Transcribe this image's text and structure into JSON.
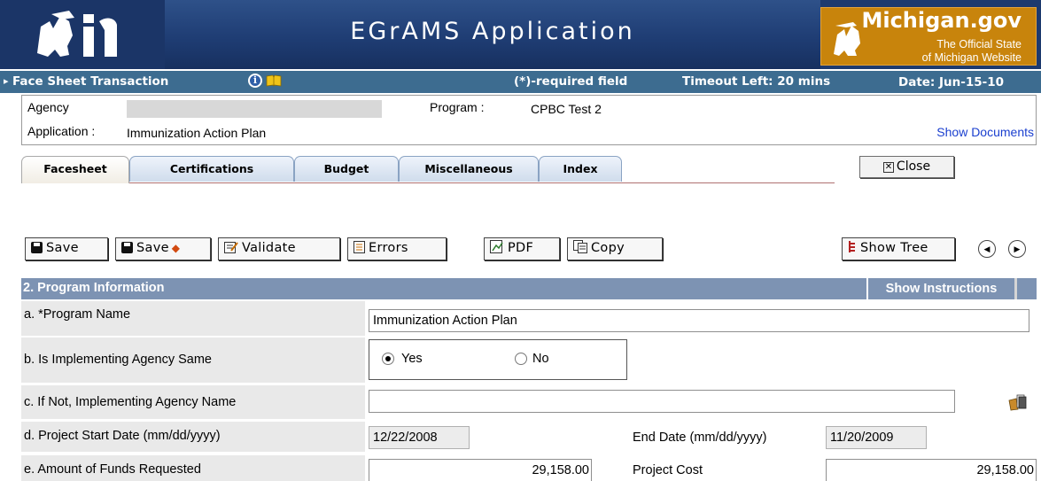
{
  "banner": {
    "app_title": "EGrAMS Application",
    "state_logo_text": "Mi",
    "mi_gov_title": "Michigan.gov",
    "mi_gov_sub1": "The Official State",
    "mi_gov_sub2": "of Michigan Website"
  },
  "status": {
    "title": "Face Sheet Transaction",
    "required": "(*)-required field",
    "timeout": "Timeout Left: 20  mins",
    "date": "Date: Jun-15-10"
  },
  "header": {
    "agency_label": "Agency",
    "agency_value": "",
    "program_label": "Program :",
    "program_value": "CPBC Test 2",
    "application_label": "Application :",
    "application_value": "Immunization Action Plan",
    "show_documents": "Show Documents"
  },
  "tabs": [
    {
      "label": "Facesheet",
      "active": true
    },
    {
      "label": "Certifications"
    },
    {
      "label": "Budget"
    },
    {
      "label": "Miscellaneous"
    },
    {
      "label": "Index"
    }
  ],
  "close_label": "Close",
  "toolbar": {
    "save": "Save",
    "save_plus": "Save",
    "validate": "Validate",
    "errors": "Errors",
    "pdf": "PDF",
    "copy": "Copy",
    "show_tree": "Show Tree"
  },
  "section": {
    "title": "2. Program Information",
    "instructions": "Show Instructions"
  },
  "form": {
    "a_label": "a. *Program Name",
    "a_value": "Immunization Action Plan",
    "b_label": "b. Is Implementing Agency Same",
    "b_yes": "Yes",
    "b_no": "No",
    "b_selected": "Yes",
    "c_label": "c. If Not, Implementing Agency Name",
    "c_value": "",
    "d_label": "d. Project Start Date (mm/dd/yyyy)",
    "d_start": "12/22/2008",
    "d_end_label": "End Date (mm/dd/yyyy)",
    "d_end": "11/20/2009",
    "e_label": "e. Amount of Funds Requested",
    "e_value": "29,158.00",
    "e_cost_label": "Project Cost",
    "e_cost": "29,158.00"
  },
  "colors": {
    "banner_blue": "#1f3d74",
    "status_bar": "#3d6c90",
    "section_bar": "#7d93b3",
    "mi_gov_orange": "#c8840c",
    "link": "#1a3fcf"
  },
  "icons": [
    "michigan-logo-icon",
    "michigan-map-icon",
    "info-icon",
    "book-icon",
    "save-disk-icon",
    "save-plus-icon",
    "validate-icon",
    "errors-icon",
    "pdf-icon",
    "copy-icon",
    "tree-icon",
    "prev-arrow-icon",
    "next-arrow-icon",
    "folder-lookup-icon"
  ]
}
